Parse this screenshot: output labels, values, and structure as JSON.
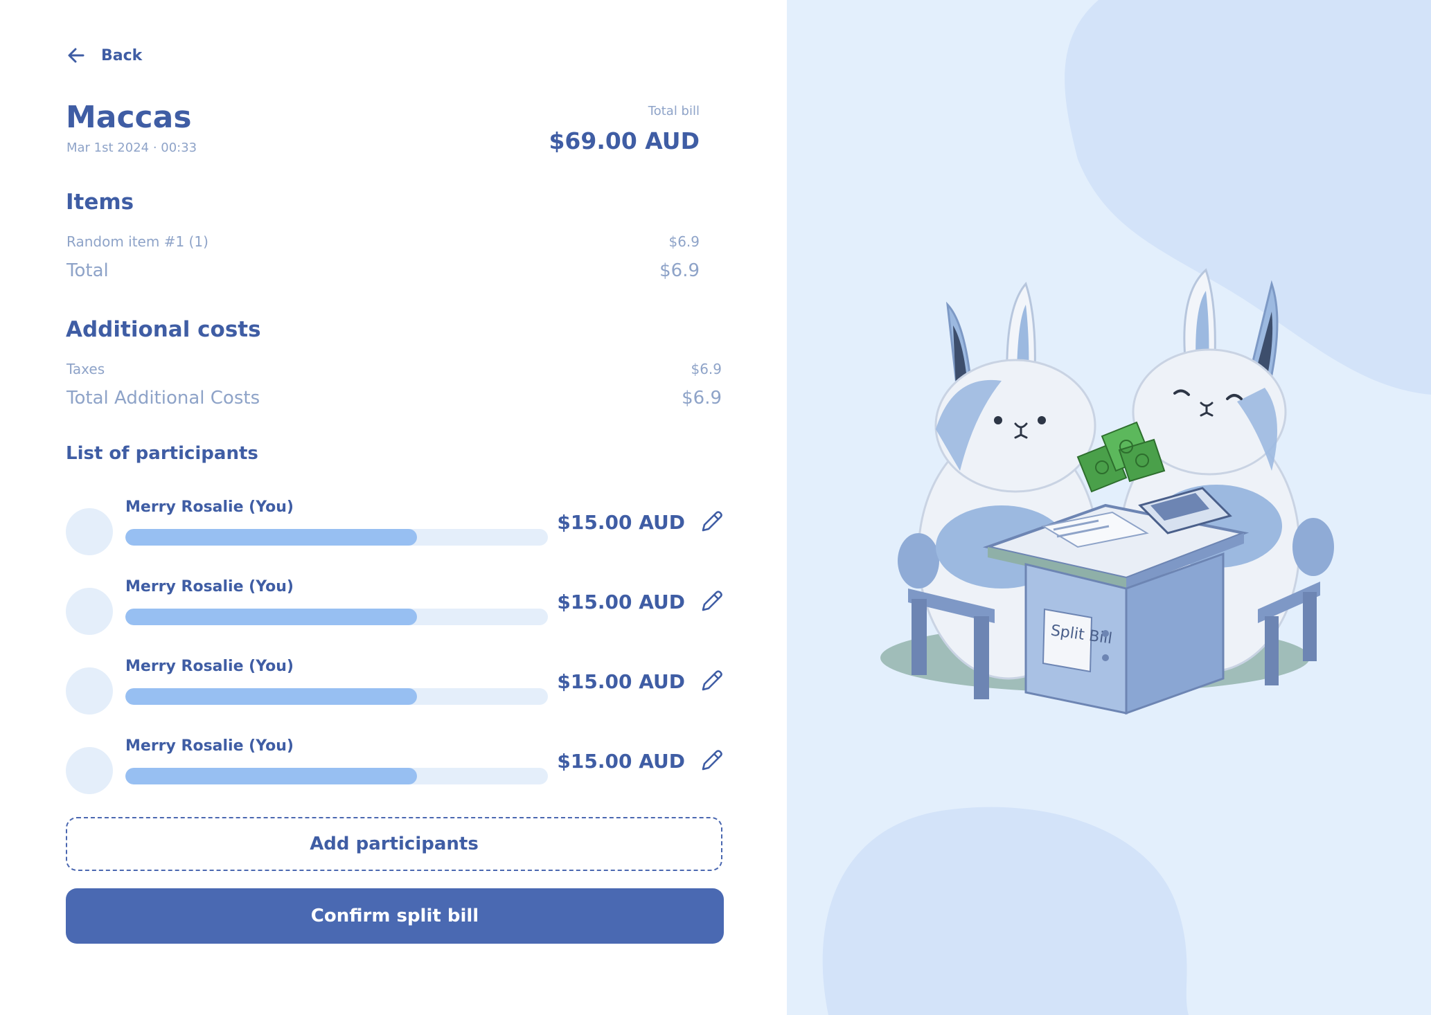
{
  "nav": {
    "back_label": "Back"
  },
  "bill": {
    "title": "Maccas",
    "date": "Mar 1st 2024 · 00:33",
    "total_label": "Total bill",
    "total_value": "$69.00 AUD"
  },
  "items": {
    "heading": "Items",
    "rows": [
      {
        "label": "Random item #1 (1)",
        "value": "$6.9"
      }
    ],
    "total_label": "Total",
    "total_value": "$6.9"
  },
  "additional": {
    "heading": "Additional costs",
    "rows": [
      {
        "label": "Taxes",
        "value": "$6.9"
      }
    ],
    "total_label": "Total Additional Costs",
    "total_value": "$6.9"
  },
  "participants": {
    "heading": "List of participants",
    "list": [
      {
        "name": "Merry Rosalie (You)",
        "amount": "$15.00 AUD",
        "share": 0.69
      },
      {
        "name": "Merry Rosalie (You)",
        "amount": "$15.00 AUD",
        "share": 0.69
      },
      {
        "name": "Merry Rosalie (You)",
        "amount": "$15.00 AUD",
        "share": 0.69
      },
      {
        "name": "Merry Rosalie (You)",
        "amount": "$15.00 AUD",
        "share": 0.69
      }
    ]
  },
  "actions": {
    "add_label": "Add participants",
    "confirm_label": "Confirm split bill"
  },
  "illustration": {
    "sign_text": "Split Bill"
  },
  "colors": {
    "primary": "#3f5da4",
    "muted": "#8ea3c8",
    "bar_fill": "#97bff2",
    "bar_track": "#e4eefa",
    "button": "#4a69b2",
    "panel_bg": "#e3effc"
  }
}
